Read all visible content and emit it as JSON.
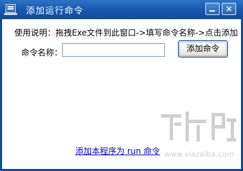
{
  "window": {
    "title": "添加运行命令",
    "minimize_glyph": "_",
    "close_glyph": "×"
  },
  "form": {
    "instruction": "使用说明：拖拽Exe文件到此窗口->填写命令名称->点击添加",
    "name_label": "命令名称：",
    "name_value": "",
    "name_placeholder": "",
    "add_button_label": "添加命令"
  },
  "footer": {
    "run_link": "添加本程序为 run 命令"
  },
  "watermark": {
    "text": "下载吧",
    "sub": "www.xiazaiba.com"
  },
  "colors": {
    "titlebar": "#1b5ab1",
    "link": "#0000cc"
  }
}
